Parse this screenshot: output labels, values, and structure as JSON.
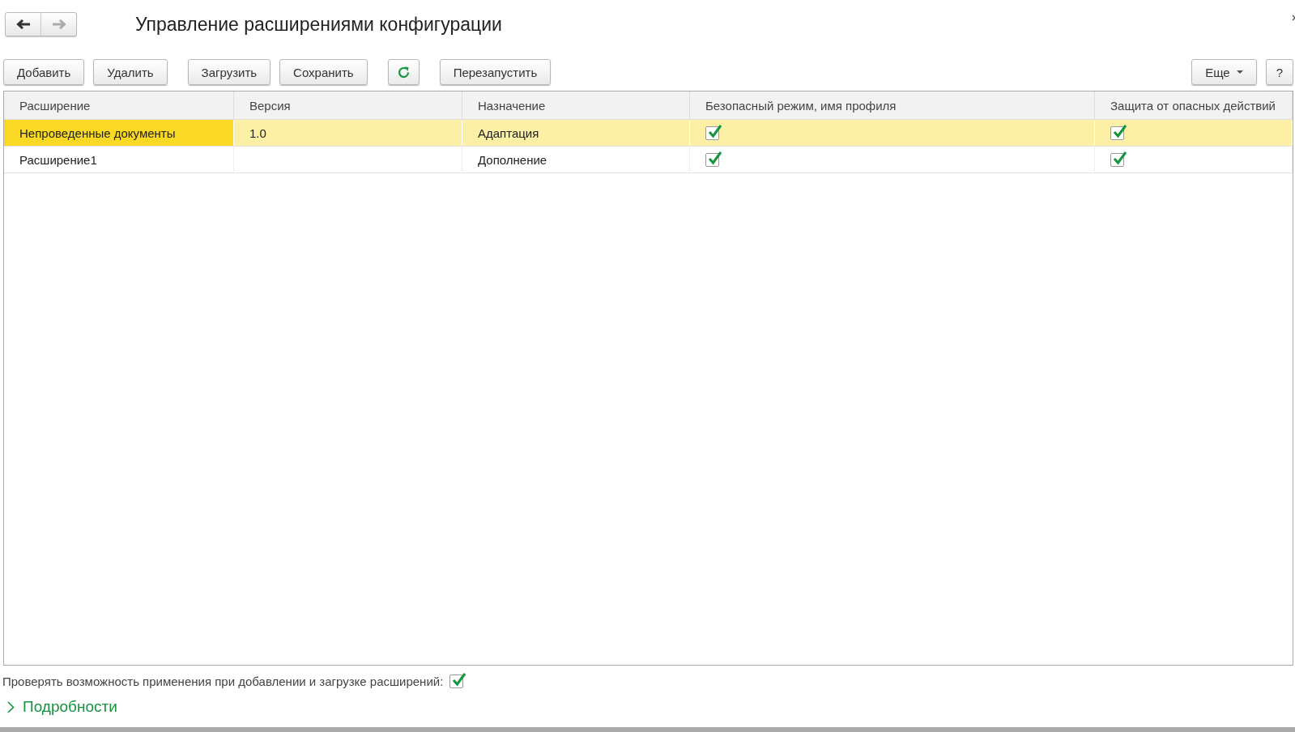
{
  "window": {
    "title": "Управление расширениями конфигурации"
  },
  "toolbar": [
    [
      {
        "kind": "text",
        "label": "Добавить"
      },
      {
        "kind": "text",
        "label": "Удалить"
      }
    ],
    [
      {
        "kind": "text",
        "label": "Загрузить"
      },
      {
        "kind": "text",
        "label": "Сохранить"
      }
    ],
    [
      {
        "kind": "refresh"
      }
    ],
    [
      {
        "kind": "text",
        "label": "Перезапустить"
      }
    ]
  ],
  "toolbar_right": [
    {
      "kind": "menu",
      "label": "Еще"
    },
    {
      "kind": "text",
      "label": "?"
    }
  ],
  "table": {
    "columns": [
      "Расширение",
      "Версия",
      "Назначение",
      "Безопасный режим, имя профиля",
      "Защита от опасных действий"
    ],
    "rows": [
      {
        "selected": true,
        "extension": "Непроведенные документы",
        "version": "1.0",
        "purpose": "Адаптация",
        "safe_mode": true,
        "protection": true
      },
      {
        "selected": false,
        "extension": "Расширение1",
        "version": "",
        "purpose": "Дополнение",
        "safe_mode": true,
        "protection": true
      }
    ]
  },
  "check_option": {
    "label": "Проверять возможность применения при добавлении и загрузке расширений:",
    "checked": true
  },
  "details": {
    "label": "Подробности",
    "expanded": false
  }
}
